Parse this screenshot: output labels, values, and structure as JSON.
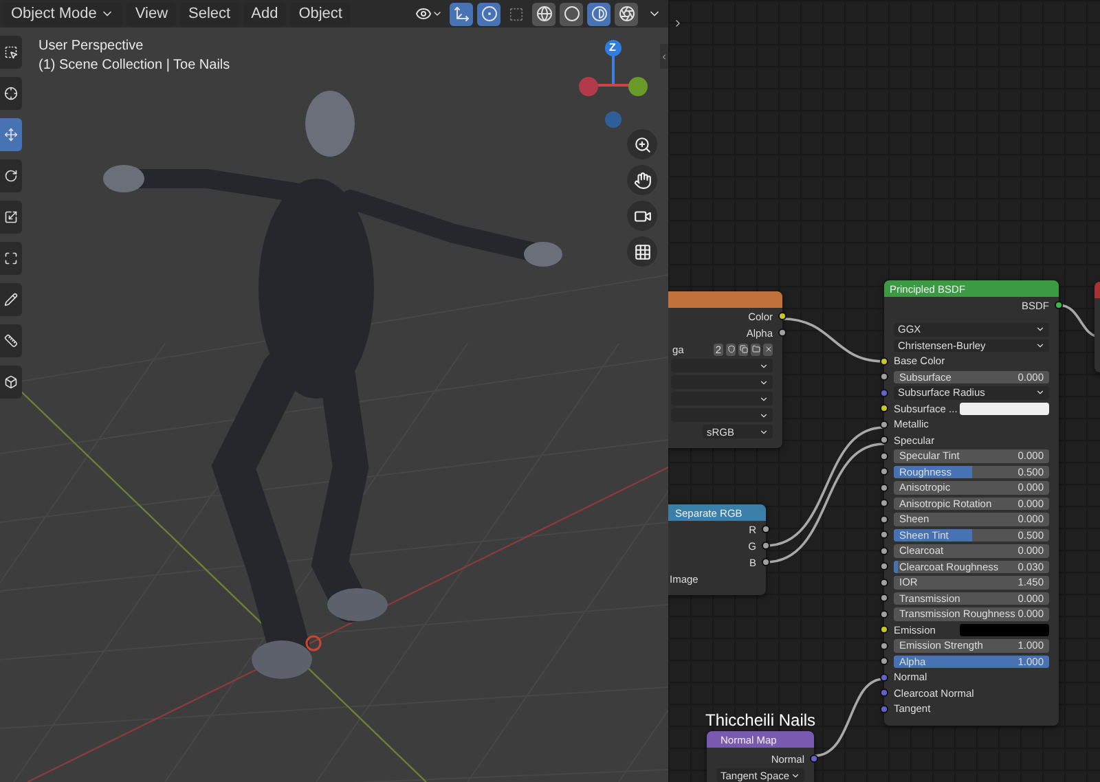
{
  "viewport": {
    "mode": "Object Mode",
    "menus": [
      "View",
      "Select",
      "Add",
      "Object"
    ],
    "shading_modes": [
      {
        "selected": false
      },
      {
        "selected": false
      },
      {
        "selected": true
      },
      {
        "selected": false
      }
    ],
    "tools": [
      {
        "selected": false
      },
      {
        "selected": false
      },
      {
        "selected": true
      },
      {
        "selected": false
      },
      {
        "selected": false
      },
      {
        "selected": false
      },
      {
        "selected": false
      },
      {
        "selected": false
      },
      {
        "selected": false
      }
    ],
    "view_name": "User Perspective",
    "scene_info": "(1) Scene Collection | Toe Nails",
    "gizmo_label": "Z"
  },
  "node_editor": {
    "image_texture": {
      "outputs": [
        "Color",
        "Alpha"
      ],
      "image_name": "ga",
      "users": "2",
      "color_space": "sRGB"
    },
    "separate_rgb": {
      "title": "Separate RGB",
      "outputs": [
        "R",
        "G",
        "B"
      ],
      "inputs": [
        "Image"
      ]
    },
    "principled": {
      "title": "Principled BSDF",
      "output": "BSDF",
      "rows": [
        {
          "kind": "dropdown",
          "label": "GGX"
        },
        {
          "kind": "dropdown",
          "label": "Christensen-Burley"
        },
        {
          "kind": "socket",
          "label": "Base Color",
          "color": "#c7c729"
        },
        {
          "kind": "slider",
          "label": "Subsurface",
          "value": "0.000",
          "color": "#a1a1a1"
        },
        {
          "kind": "vector",
          "label": "Subsurface Radius",
          "color": "#6363c7"
        },
        {
          "kind": "swatch",
          "label": "Subsurface ...",
          "color": "#f0f0f0"
        },
        {
          "kind": "socket",
          "label": "Metallic",
          "color": "#a1a1a1"
        },
        {
          "kind": "socket",
          "label": "Specular",
          "color": "#a1a1a1"
        },
        {
          "kind": "slider",
          "label": "Specular Tint",
          "value": "0.000",
          "color": "#a1a1a1"
        },
        {
          "kind": "slider",
          "label": "Roughness",
          "value": "0.500",
          "level": 0.5,
          "color": "#a1a1a1"
        },
        {
          "kind": "slider",
          "label": "Anisotropic",
          "value": "0.000",
          "color": "#a1a1a1"
        },
        {
          "kind": "slider",
          "label": "Anisotropic Rotation",
          "value": "0.000",
          "color": "#a1a1a1"
        },
        {
          "kind": "slider",
          "label": "Sheen",
          "value": "0.000",
          "color": "#a1a1a1"
        },
        {
          "kind": "slider",
          "label": "Sheen Tint",
          "value": "0.500",
          "level": 0.5,
          "color": "#a1a1a1"
        },
        {
          "kind": "slider",
          "label": "Clearcoat",
          "value": "0.000",
          "color": "#a1a1a1"
        },
        {
          "kind": "slider",
          "label": "Clearcoat Roughness",
          "value": "0.030",
          "level": 0.03,
          "color": "#a1a1a1"
        },
        {
          "kind": "slider",
          "label": "IOR",
          "value": "1.450",
          "color": "#a1a1a1"
        },
        {
          "kind": "slider",
          "label": "Transmission",
          "value": "0.000",
          "color": "#a1a1a1"
        },
        {
          "kind": "slider",
          "label": "Transmission Roughness",
          "value": "0.000",
          "color": "#a1a1a1"
        },
        {
          "kind": "swatch",
          "label": "Emission",
          "color": "#000000"
        },
        {
          "kind": "slider",
          "label": "Emission Strength",
          "value": "1.000",
          "color": "#a1a1a1"
        },
        {
          "kind": "slider",
          "label": "Alpha",
          "value": "1.000",
          "level": 1,
          "color": "#a1a1a1"
        },
        {
          "kind": "socket",
          "label": "Normal",
          "color": "#6363c7"
        },
        {
          "kind": "socket",
          "label": "Clearcoat Normal",
          "color": "#6363c7"
        },
        {
          "kind": "socket",
          "label": "Tangent",
          "color": "#6363c7"
        }
      ]
    },
    "normal_map": {
      "title": "Normal Map",
      "label": "Thiccheili Nails",
      "output": "Normal",
      "space": "Tangent Space"
    }
  }
}
